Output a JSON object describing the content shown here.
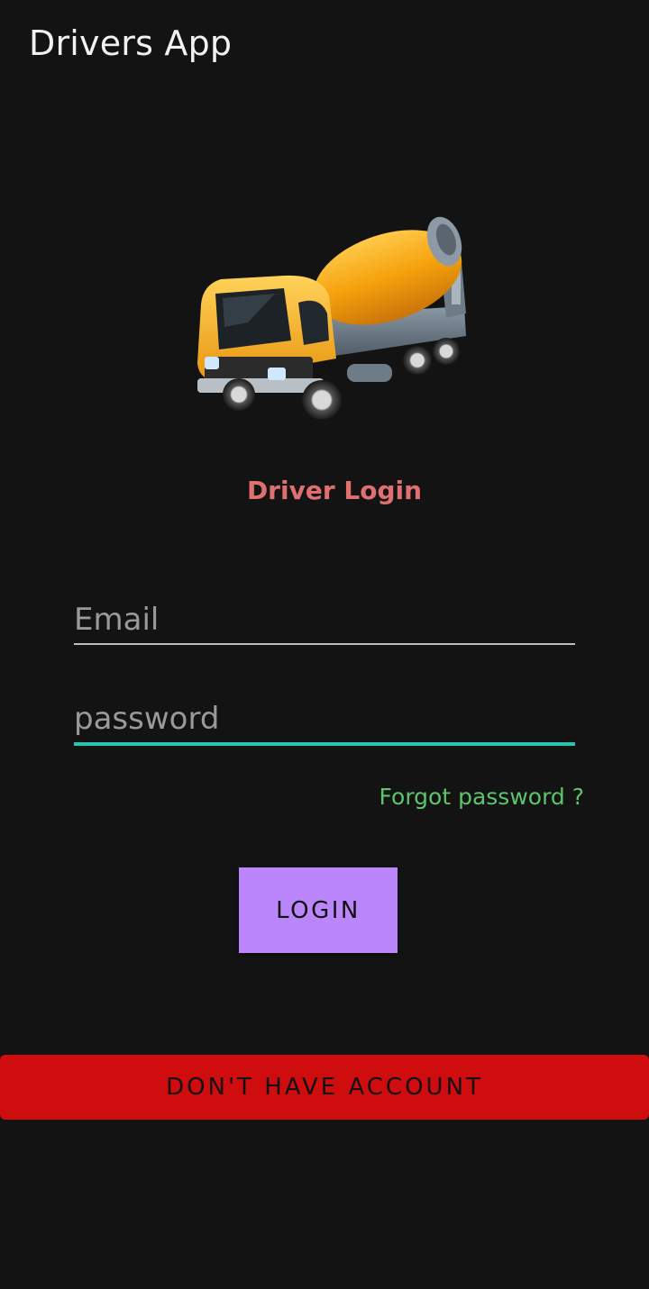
{
  "app": {
    "title": "Drivers App"
  },
  "logo": {
    "icon": "concrete-mixer-truck-icon"
  },
  "login": {
    "heading": "Driver Login",
    "email_placeholder": "Email",
    "email_value": "",
    "password_placeholder": "password",
    "password_value": "",
    "forgot_label": "Forgot password ?",
    "login_label": "LOGIN",
    "no_account_label": "DON'T HAVE ACCOUNT"
  },
  "colors": {
    "background": "#131313",
    "heading": "#e07070",
    "focus_underline": "#26c6b2",
    "forgot_link": "#5cc46a",
    "login_button": "#bb86fc",
    "account_button": "#cf0c0e"
  }
}
